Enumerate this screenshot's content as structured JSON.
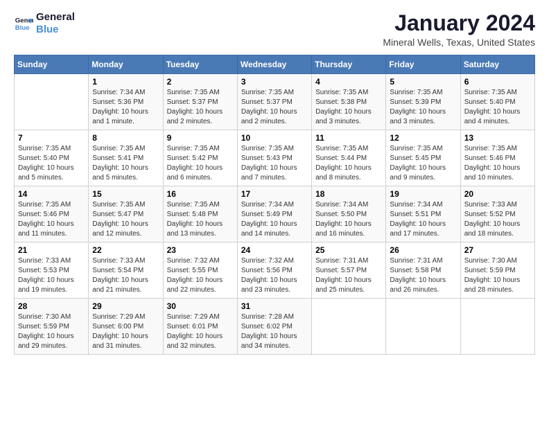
{
  "logo": {
    "line1": "General",
    "line2": "Blue"
  },
  "title": "January 2024",
  "location": "Mineral Wells, Texas, United States",
  "weekdays": [
    "Sunday",
    "Monday",
    "Tuesday",
    "Wednesday",
    "Thursday",
    "Friday",
    "Saturday"
  ],
  "weeks": [
    [
      {
        "day": "",
        "info": ""
      },
      {
        "day": "1",
        "info": "Sunrise: 7:34 AM\nSunset: 5:36 PM\nDaylight: 10 hours\nand 1 minute."
      },
      {
        "day": "2",
        "info": "Sunrise: 7:35 AM\nSunset: 5:37 PM\nDaylight: 10 hours\nand 2 minutes."
      },
      {
        "day": "3",
        "info": "Sunrise: 7:35 AM\nSunset: 5:37 PM\nDaylight: 10 hours\nand 2 minutes."
      },
      {
        "day": "4",
        "info": "Sunrise: 7:35 AM\nSunset: 5:38 PM\nDaylight: 10 hours\nand 3 minutes."
      },
      {
        "day": "5",
        "info": "Sunrise: 7:35 AM\nSunset: 5:39 PM\nDaylight: 10 hours\nand 3 minutes."
      },
      {
        "day": "6",
        "info": "Sunrise: 7:35 AM\nSunset: 5:40 PM\nDaylight: 10 hours\nand 4 minutes."
      }
    ],
    [
      {
        "day": "7",
        "info": "Sunrise: 7:35 AM\nSunset: 5:40 PM\nDaylight: 10 hours\nand 5 minutes."
      },
      {
        "day": "8",
        "info": "Sunrise: 7:35 AM\nSunset: 5:41 PM\nDaylight: 10 hours\nand 5 minutes."
      },
      {
        "day": "9",
        "info": "Sunrise: 7:35 AM\nSunset: 5:42 PM\nDaylight: 10 hours\nand 6 minutes."
      },
      {
        "day": "10",
        "info": "Sunrise: 7:35 AM\nSunset: 5:43 PM\nDaylight: 10 hours\nand 7 minutes."
      },
      {
        "day": "11",
        "info": "Sunrise: 7:35 AM\nSunset: 5:44 PM\nDaylight: 10 hours\nand 8 minutes."
      },
      {
        "day": "12",
        "info": "Sunrise: 7:35 AM\nSunset: 5:45 PM\nDaylight: 10 hours\nand 9 minutes."
      },
      {
        "day": "13",
        "info": "Sunrise: 7:35 AM\nSunset: 5:46 PM\nDaylight: 10 hours\nand 10 minutes."
      }
    ],
    [
      {
        "day": "14",
        "info": "Sunrise: 7:35 AM\nSunset: 5:46 PM\nDaylight: 10 hours\nand 11 minutes."
      },
      {
        "day": "15",
        "info": "Sunrise: 7:35 AM\nSunset: 5:47 PM\nDaylight: 10 hours\nand 12 minutes."
      },
      {
        "day": "16",
        "info": "Sunrise: 7:35 AM\nSunset: 5:48 PM\nDaylight: 10 hours\nand 13 minutes."
      },
      {
        "day": "17",
        "info": "Sunrise: 7:34 AM\nSunset: 5:49 PM\nDaylight: 10 hours\nand 14 minutes."
      },
      {
        "day": "18",
        "info": "Sunrise: 7:34 AM\nSunset: 5:50 PM\nDaylight: 10 hours\nand 16 minutes."
      },
      {
        "day": "19",
        "info": "Sunrise: 7:34 AM\nSunset: 5:51 PM\nDaylight: 10 hours\nand 17 minutes."
      },
      {
        "day": "20",
        "info": "Sunrise: 7:33 AM\nSunset: 5:52 PM\nDaylight: 10 hours\nand 18 minutes."
      }
    ],
    [
      {
        "day": "21",
        "info": "Sunrise: 7:33 AM\nSunset: 5:53 PM\nDaylight: 10 hours\nand 19 minutes."
      },
      {
        "day": "22",
        "info": "Sunrise: 7:33 AM\nSunset: 5:54 PM\nDaylight: 10 hours\nand 21 minutes."
      },
      {
        "day": "23",
        "info": "Sunrise: 7:32 AM\nSunset: 5:55 PM\nDaylight: 10 hours\nand 22 minutes."
      },
      {
        "day": "24",
        "info": "Sunrise: 7:32 AM\nSunset: 5:56 PM\nDaylight: 10 hours\nand 23 minutes."
      },
      {
        "day": "25",
        "info": "Sunrise: 7:31 AM\nSunset: 5:57 PM\nDaylight: 10 hours\nand 25 minutes."
      },
      {
        "day": "26",
        "info": "Sunrise: 7:31 AM\nSunset: 5:58 PM\nDaylight: 10 hours\nand 26 minutes."
      },
      {
        "day": "27",
        "info": "Sunrise: 7:30 AM\nSunset: 5:59 PM\nDaylight: 10 hours\nand 28 minutes."
      }
    ],
    [
      {
        "day": "28",
        "info": "Sunrise: 7:30 AM\nSunset: 5:59 PM\nDaylight: 10 hours\nand 29 minutes."
      },
      {
        "day": "29",
        "info": "Sunrise: 7:29 AM\nSunset: 6:00 PM\nDaylight: 10 hours\nand 31 minutes."
      },
      {
        "day": "30",
        "info": "Sunrise: 7:29 AM\nSunset: 6:01 PM\nDaylight: 10 hours\nand 32 minutes."
      },
      {
        "day": "31",
        "info": "Sunrise: 7:28 AM\nSunset: 6:02 PM\nDaylight: 10 hours\nand 34 minutes."
      },
      {
        "day": "",
        "info": ""
      },
      {
        "day": "",
        "info": ""
      },
      {
        "day": "",
        "info": ""
      }
    ]
  ]
}
